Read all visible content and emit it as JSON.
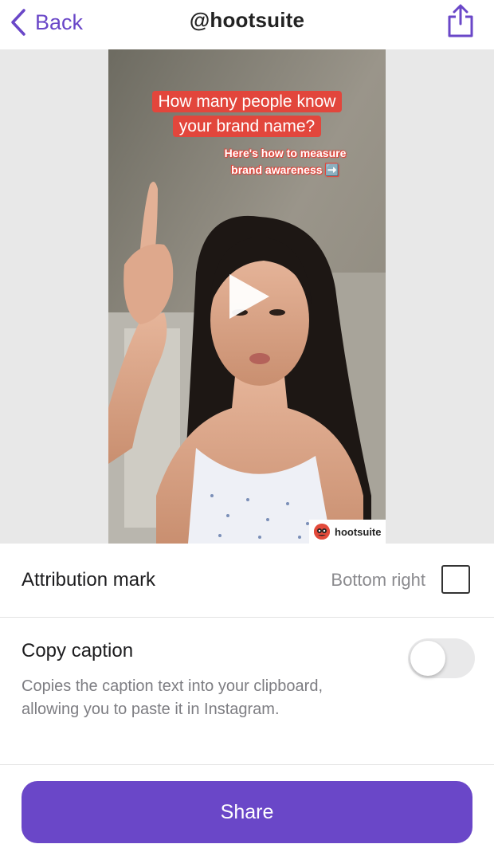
{
  "header": {
    "back_label": "Back",
    "title": "@hootsuite",
    "back_icon": "chevron-left-icon",
    "share_icon": "share-upload-icon",
    "accent_color": "#6a47c8"
  },
  "preview": {
    "headline": "How many people know your brand name?",
    "subhead": "Here's how to measure brand awareness ➡️",
    "watermark_text": "hootsuite",
    "play_icon": "play-icon"
  },
  "attribution": {
    "label": "Attribution mark",
    "value": "Bottom right",
    "checked": false
  },
  "copy_caption": {
    "label": "Copy caption",
    "description": "Copies the caption text into your clipboard, allowing you to paste it in Instagram.",
    "enabled": false
  },
  "share_button": {
    "label": "Share"
  }
}
